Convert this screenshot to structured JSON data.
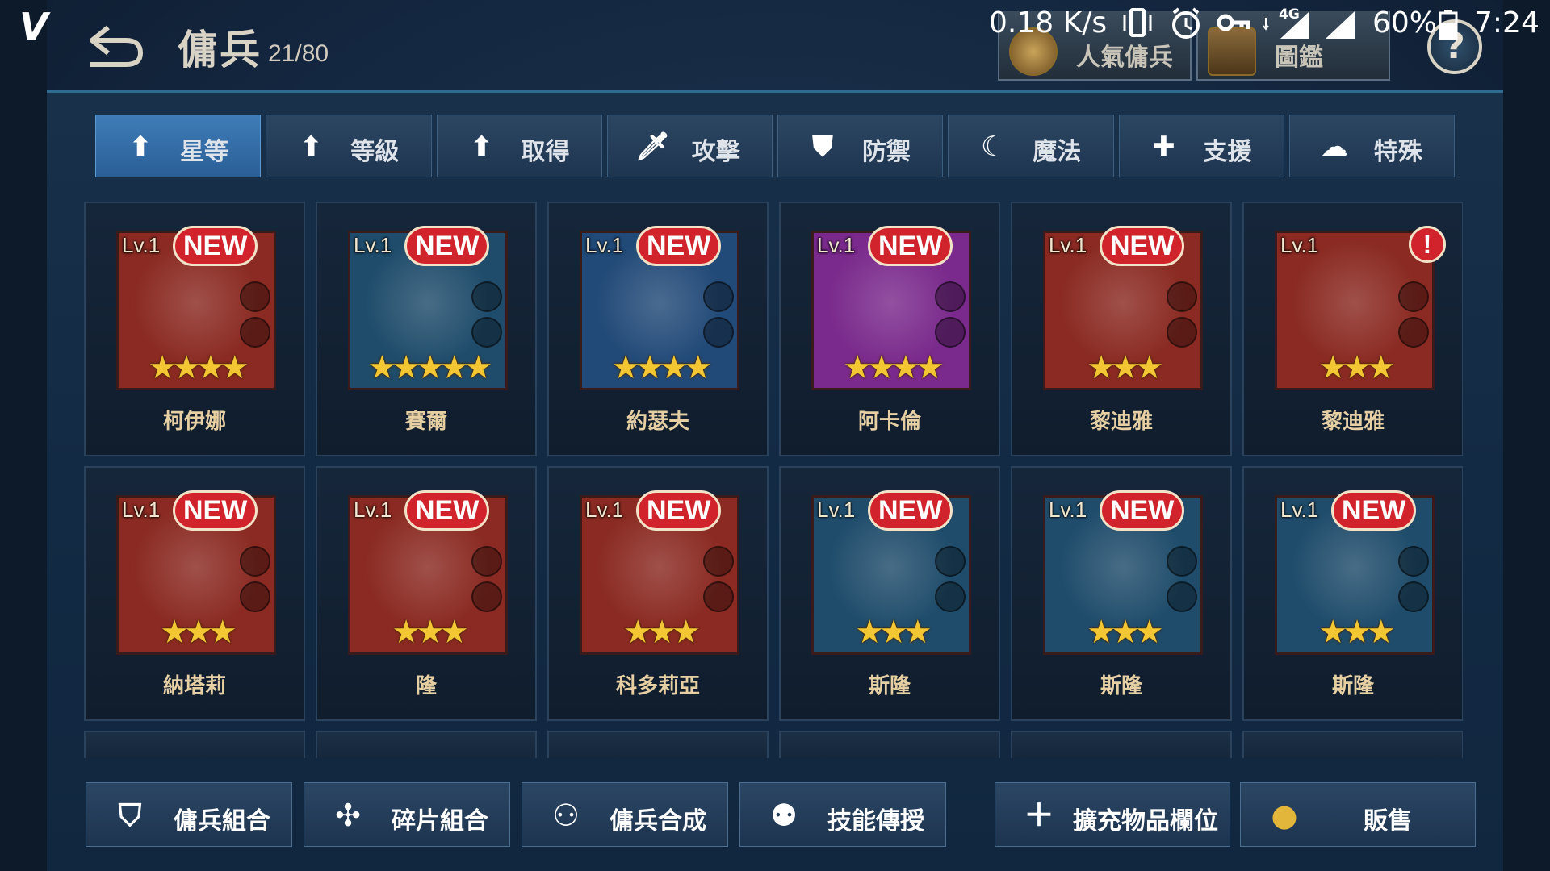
{
  "status_bar": {
    "net_speed": "0.18 K/s",
    "network": "4G",
    "battery": "60%",
    "time": "7:24"
  },
  "header": {
    "title": "傭兵",
    "count": "21/80",
    "top_tabs": [
      {
        "label": "人氣傭兵",
        "icon": "popular-mercenary-icon"
      },
      {
        "label": "圖鑑",
        "icon": "encyclopedia-icon"
      }
    ],
    "help": "?"
  },
  "sort_tabs": [
    {
      "label": "星等",
      "icon": "up-arrow-icon",
      "active": true
    },
    {
      "label": "等級",
      "icon": "up-arrow-icon",
      "active": false
    },
    {
      "label": "取得",
      "icon": "up-arrow-icon",
      "active": false
    },
    {
      "label": "攻擊",
      "icon": "sword-icon",
      "active": false
    },
    {
      "label": "防禦",
      "icon": "shield-icon",
      "active": false
    },
    {
      "label": "魔法",
      "icon": "magic-icon",
      "active": false
    },
    {
      "label": "支援",
      "icon": "support-icon",
      "active": false
    },
    {
      "label": "特殊",
      "icon": "special-icon",
      "active": false
    }
  ],
  "mercenaries": [
    {
      "name": "柯伊娜",
      "level": "Lv.1",
      "stars": 4,
      "badge": "NEW",
      "bg": "#8a2a22"
    },
    {
      "name": "賽爾",
      "level": "Lv.1",
      "stars": 5,
      "badge": "NEW",
      "bg": "#1f4c6b"
    },
    {
      "name": "約瑟夫",
      "level": "Lv.1",
      "stars": 4,
      "badge": "NEW",
      "bg": "#224a78"
    },
    {
      "name": "阿卡倫",
      "level": "Lv.1",
      "stars": 4,
      "badge": "NEW",
      "bg": "#7a2a8c"
    },
    {
      "name": "黎迪雅",
      "level": "Lv.1",
      "stars": 3,
      "badge": "NEW",
      "bg": "#8a2a22"
    },
    {
      "name": "黎迪雅",
      "level": "Lv.1",
      "stars": 3,
      "badge": "!",
      "bg": "#8a2a22"
    },
    {
      "name": "納塔莉",
      "level": "Lv.1",
      "stars": 3,
      "badge": "NEW",
      "bg": "#8a2a22"
    },
    {
      "name": "隆",
      "level": "Lv.1",
      "stars": 3,
      "badge": "NEW",
      "bg": "#8a2a22"
    },
    {
      "name": "科多莉亞",
      "level": "Lv.1",
      "stars": 3,
      "badge": "NEW",
      "bg": "#8a2a22"
    },
    {
      "name": "斯隆",
      "level": "Lv.1",
      "stars": 3,
      "badge": "NEW",
      "bg": "#1f4c6b"
    },
    {
      "name": "斯隆",
      "level": "Lv.1",
      "stars": 3,
      "badge": "NEW",
      "bg": "#1f4c6b"
    },
    {
      "name": "斯隆",
      "level": "Lv.1",
      "stars": 3,
      "badge": "NEW",
      "bg": "#1f4c6b"
    }
  ],
  "bottom_actions": [
    {
      "label": "傭兵組合",
      "icon": "mercenary-group-icon"
    },
    {
      "label": "碎片組合",
      "icon": "puzzle-icon"
    },
    {
      "label": "傭兵合成",
      "icon": "merge-icon"
    },
    {
      "label": "技能傳授",
      "icon": "skill-transfer-icon"
    },
    {
      "label": "擴充物品欄位",
      "icon": "plus-icon"
    },
    {
      "label": "販售",
      "icon": "gold-coin-icon"
    }
  ],
  "colors": {
    "active_tab": "#3f7cb8",
    "badge": "#d0232b",
    "star": "#f3c634",
    "name_text": "#e6cfa3"
  }
}
